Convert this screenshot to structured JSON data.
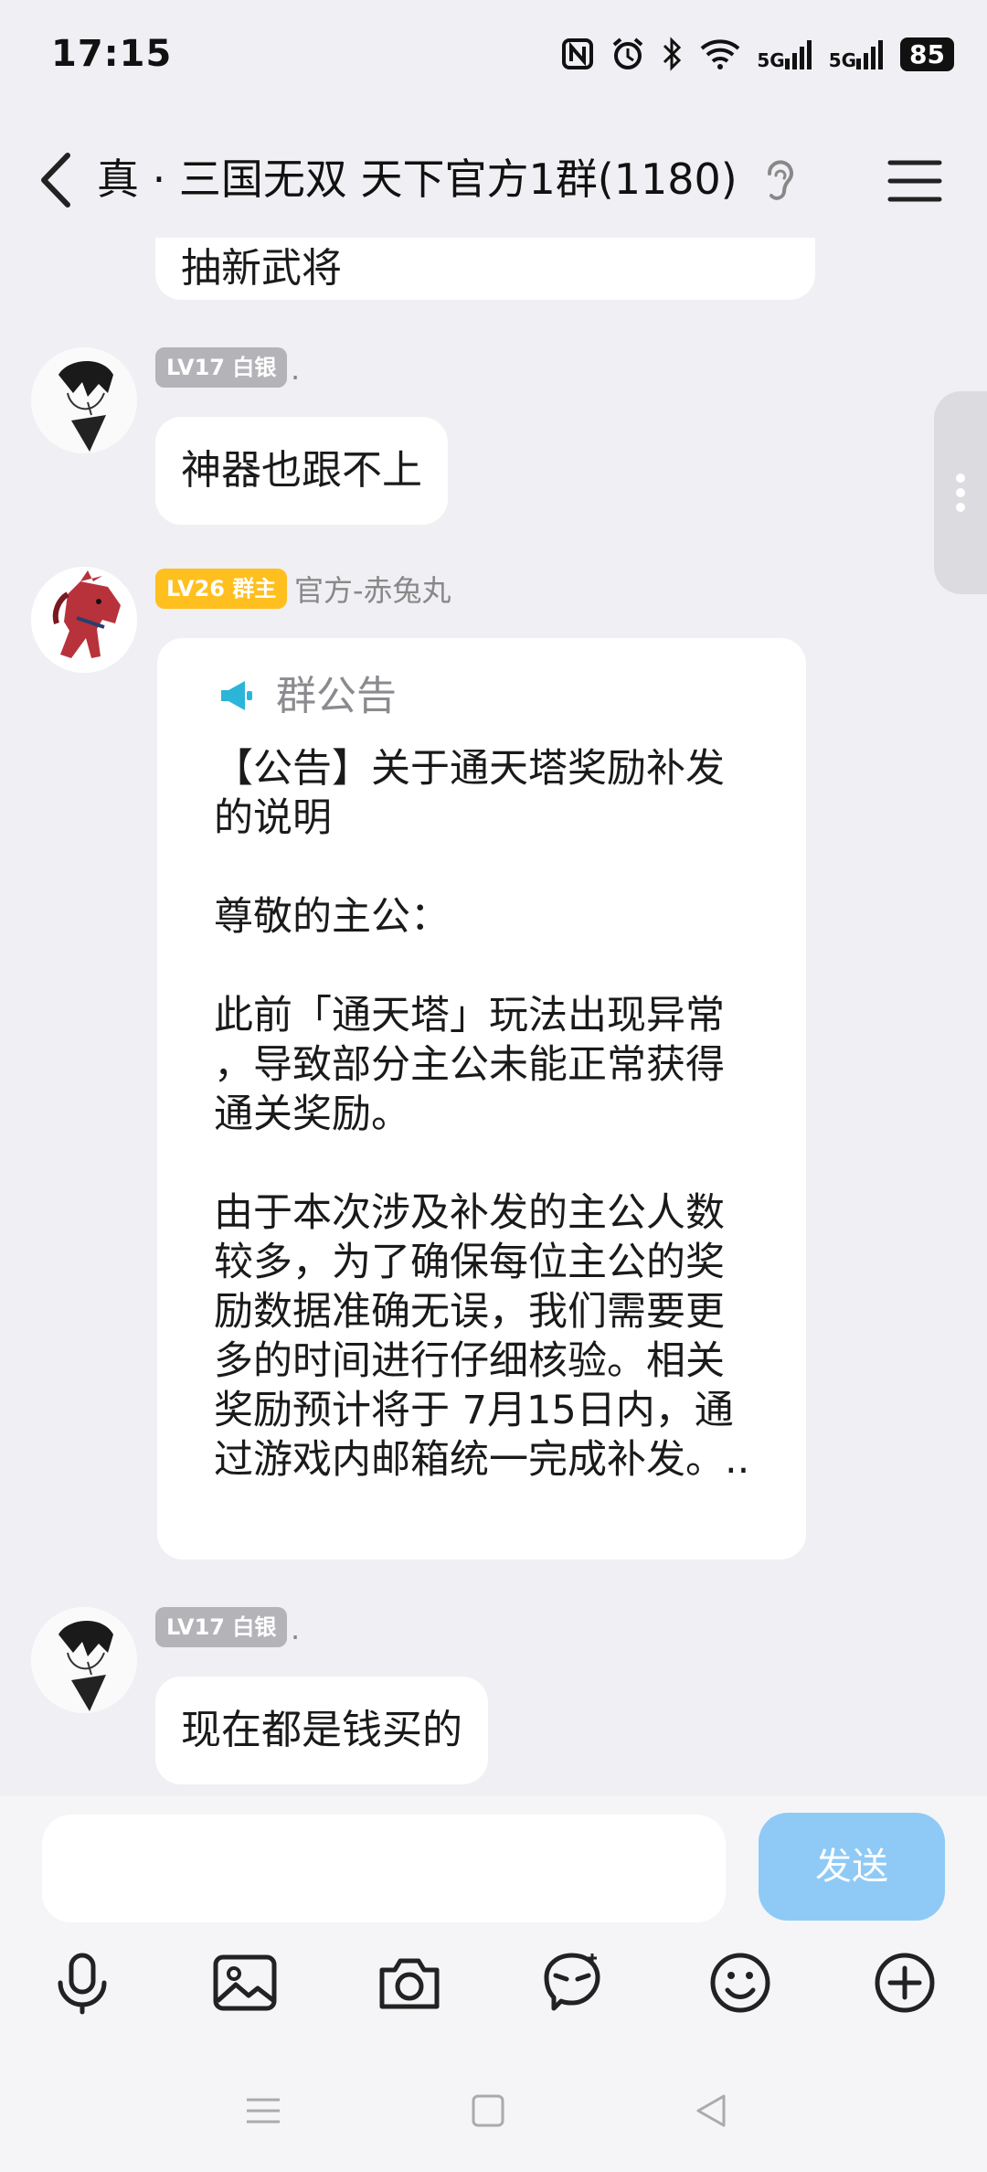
{
  "status_bar": {
    "time": "17:15",
    "signal_1": "5G",
    "signal_2": "5G",
    "battery": "85",
    "icons": [
      "nfc-icon",
      "alarm-icon",
      "bluetooth-icon",
      "wifi-icon",
      "signal-icon",
      "signal-icon",
      "battery-icon"
    ]
  },
  "header": {
    "title": "真 · 三国无双 天下官方1群(1180)",
    "icons": [
      "back-arrow-icon",
      "ear-icon",
      "menu-icon"
    ]
  },
  "messages": [
    {
      "type": "text",
      "text": "抽新武将"
    },
    {
      "type": "text",
      "level": "LV17 白银",
      "nickname": ".",
      "text": "神器也跟不上"
    },
    {
      "type": "notice",
      "level": "LV26 群主",
      "nickname": "官方-赤兔丸",
      "header": "群公告",
      "body": "【公告】关于通天塔奖励补发\n的说明\n\n尊敬的主公：\n\n此前「通天塔」玩法出现异常\n，导致部分主公未能正常获得\n通关奖励。\n\n由于本次涉及补发的主公人数\n较多，为了确保每位主公的奖\n励数据准确无误，我们需要更\n多的时间进行仔细核验。相关\n奖励预计将于 7月15日内，通\n过游戏内邮箱统一完成补发。.."
    },
    {
      "type": "text",
      "level": "LV17 白银",
      "nickname": ".",
      "text": "现在都是钱买的"
    }
  ],
  "composer": {
    "send_label": "发送",
    "input_value": "",
    "tools": [
      "microphone-icon",
      "image-icon",
      "camera-icon",
      "sticker-icon",
      "emoji-icon",
      "plus-icon"
    ]
  },
  "nav": [
    "recent-apps-icon",
    "home-icon",
    "back-icon"
  ],
  "colors": {
    "send_button": "#8fcaf6",
    "badge_gold": "#ffbf1f",
    "badge_silver": "#b3b3b8",
    "announce_icon": "#2bb5d8"
  }
}
